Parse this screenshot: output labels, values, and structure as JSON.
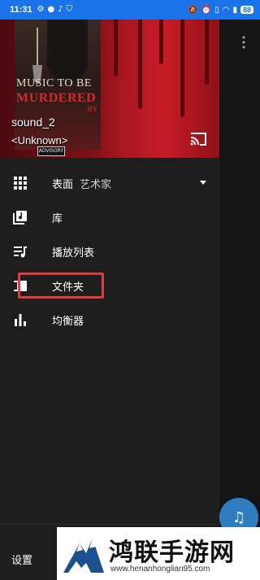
{
  "status_bar": {
    "time": "11:31",
    "battery": "88",
    "left_icons": [
      "gear-icon",
      "dot-icon",
      "tiktok-icon",
      "shield-icon"
    ],
    "right_icons": [
      "mute-icon",
      "alarm-icon",
      "vibrate-icon",
      "wifi-icon",
      "signal-icon"
    ]
  },
  "now_playing": {
    "title": "sound_2",
    "artist": "<Unknown>",
    "album_art_text": {
      "line1": "MUSIC TO BE",
      "line2": "MURDERED",
      "line3": "BY",
      "advisory": "ADVISORY"
    }
  },
  "menu": {
    "items": [
      {
        "icon": "grid-icon",
        "label": "表面",
        "sublabel": "艺术家",
        "has_dropdown": true
      },
      {
        "icon": "library-icon",
        "label": "库"
      },
      {
        "icon": "playlist-icon",
        "label": "播放列表"
      },
      {
        "icon": "folder-icon",
        "label": "文件夹"
      },
      {
        "icon": "equalizer-icon",
        "label": "均衡器"
      }
    ],
    "settings_label": "设置"
  },
  "colors": {
    "status_bar": "#1a73e8",
    "drawer_bg": "#1e1e1e",
    "highlight": "#e23b3b",
    "fab": "#2f7ec2"
  },
  "watermark": {
    "title": "鸿联手游网",
    "url": "www.henanhonglian95.com"
  }
}
